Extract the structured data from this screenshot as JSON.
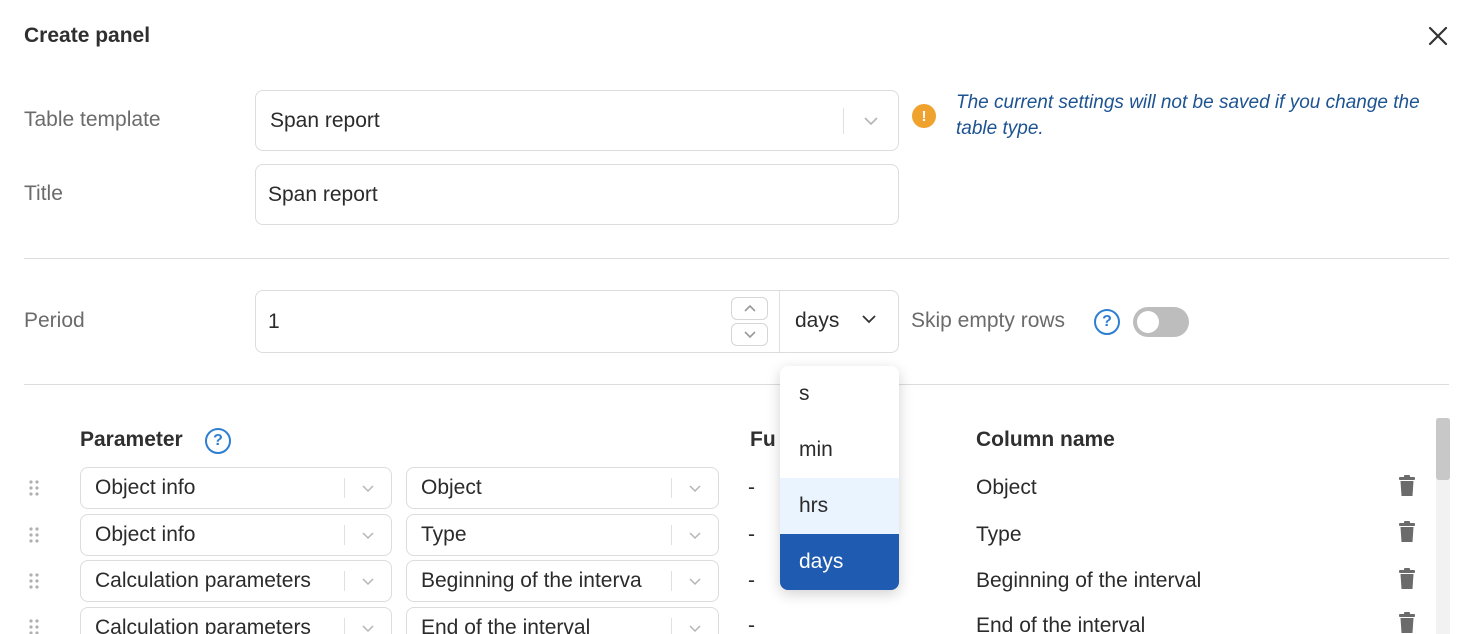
{
  "dialog": {
    "title": "Create panel"
  },
  "form": {
    "table_template": {
      "label": "Table template",
      "value": "Span report"
    },
    "title": {
      "label": "Title",
      "value": "Span report"
    },
    "warning": "The current settings will not be saved if you change the table type.",
    "period": {
      "label": "Period",
      "value": "1",
      "unit": "days",
      "unit_options": [
        "s",
        "min",
        "hrs",
        "days"
      ],
      "hovered_option": "hrs",
      "selected_option": "days"
    },
    "skip_empty_rows": {
      "label": "Skip empty rows",
      "help": "?",
      "enabled": false
    }
  },
  "table": {
    "headers": {
      "parameter": "Parameter",
      "parameter_help": "?",
      "function": "Fu",
      "column_name": "Column name"
    },
    "rows": [
      {
        "category": "Object info",
        "parameter": "Object",
        "function": "-",
        "column_name": "Object"
      },
      {
        "category": "Object info",
        "parameter": "Type",
        "function": "-",
        "column_name": "Type"
      },
      {
        "category": "Calculation parameters",
        "parameter": "Beginning of the interva",
        "function": "-",
        "column_name": "Beginning of the interval"
      },
      {
        "category": "Calculation parameters",
        "parameter": "End of the interval",
        "function": "-",
        "column_name": "End of the interval"
      }
    ]
  },
  "colors": {
    "accent": "#1f5bb0",
    "warning": "#f0a22e",
    "help": "#2f7fd1",
    "warning_text": "#1d5391"
  },
  "icons": [
    "close-icon",
    "chevron-down-icon",
    "warning-icon",
    "help-icon",
    "chevron-up-icon",
    "drag-handle-icon",
    "trash-icon"
  ]
}
